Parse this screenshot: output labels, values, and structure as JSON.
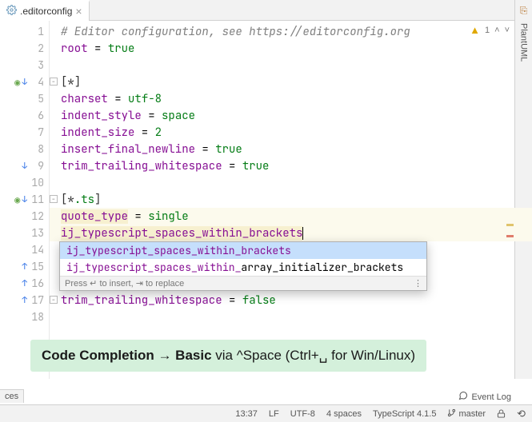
{
  "tab": {
    "filename": ".editorconfig"
  },
  "side_tool": {
    "label": "PlantUML"
  },
  "inspection": {
    "warning_count": "1"
  },
  "lines": [
    {
      "n": 1,
      "segs": [
        {
          "c": "c-comment",
          "t": "# Editor configuration, see "
        },
        {
          "c": "c-comment",
          "t": "https://editorconfig.org",
          "link": true
        }
      ]
    },
    {
      "n": 2,
      "segs": [
        {
          "c": "c-key",
          "t": "root"
        },
        {
          "c": "c-eq",
          "t": " = "
        },
        {
          "c": "c-val",
          "t": "true"
        }
      ]
    },
    {
      "n": 3,
      "segs": []
    },
    {
      "n": 4,
      "segs": [
        {
          "c": "c-sec",
          "t": "[*]"
        }
      ],
      "eye": true,
      "arrowdn": true,
      "fold": true
    },
    {
      "n": 5,
      "segs": [
        {
          "c": "c-key",
          "t": "charset"
        },
        {
          "c": "c-eq",
          "t": " = "
        },
        {
          "c": "c-val",
          "t": "utf-8"
        }
      ]
    },
    {
      "n": 6,
      "segs": [
        {
          "c": "c-key",
          "t": "indent_style"
        },
        {
          "c": "c-eq",
          "t": " = "
        },
        {
          "c": "c-val",
          "t": "space"
        }
      ]
    },
    {
      "n": 7,
      "segs": [
        {
          "c": "c-key",
          "t": "indent_size"
        },
        {
          "c": "c-eq",
          "t": " = "
        },
        {
          "c": "c-val",
          "t": "2"
        }
      ]
    },
    {
      "n": 8,
      "segs": [
        {
          "c": "c-key",
          "t": "insert_final_newline"
        },
        {
          "c": "c-eq",
          "t": " = "
        },
        {
          "c": "c-val",
          "t": "true"
        }
      ]
    },
    {
      "n": 9,
      "segs": [
        {
          "c": "c-key",
          "t": "trim_trailing_whitespace"
        },
        {
          "c": "c-eq",
          "t": " = "
        },
        {
          "c": "c-val",
          "t": "true"
        }
      ],
      "arrowdn": true
    },
    {
      "n": 10,
      "segs": []
    },
    {
      "n": 11,
      "segs": [
        {
          "c": "c-sec",
          "t": "[*"
        },
        {
          "c": "c-val",
          "t": ".ts"
        },
        {
          "c": "c-sec",
          "t": "]"
        }
      ],
      "eye": true,
      "arrowdn": true,
      "fold": true
    },
    {
      "n": 12,
      "segs": [
        {
          "c": "c-key hl-strong",
          "t": "quote_type"
        },
        {
          "c": "c-eq",
          "t": " = "
        },
        {
          "c": "c-val",
          "t": "single"
        }
      ],
      "hl": true
    },
    {
      "n": 13,
      "segs": [
        {
          "c": "c-match hl-strong",
          "t": "ij_typescript_spaces_within_brackets"
        }
      ],
      "hl": true,
      "caret": true
    },
    {
      "n": 14,
      "segs": [],
      "hidden": true
    },
    {
      "n": 15,
      "segs": [],
      "hidden": true,
      "arrowup": true
    },
    {
      "n": 16,
      "segs": [],
      "arrowup": true
    },
    {
      "n": 17,
      "segs": [
        {
          "c": "c-key",
          "t": "trim_trailing_whitespace"
        },
        {
          "c": "c-eq",
          "t": " = "
        },
        {
          "c": "c-val",
          "t": "false"
        }
      ],
      "arrowup": true,
      "fold": true
    },
    {
      "n": 18,
      "segs": []
    }
  ],
  "completion": {
    "items": [
      {
        "prefix": "ij_typescript_spaces_within_brackets",
        "rest": ""
      },
      {
        "prefix": "ij_typescript_spaces_within_",
        "rest": "array_initializer_brackets"
      }
    ],
    "footer": "Press ↵ to insert, ⇥ to replace"
  },
  "hint": {
    "strong1": "Code Completion",
    "arrow": " → ",
    "strong2": "Basic",
    "rest": " via ^Space (Ctrl+␣ for Win/Linux)"
  },
  "bottom_left": "ces",
  "event_log": "Event Log",
  "status": {
    "pos": "13:37",
    "le": "LF",
    "enc": "UTF-8",
    "indent": "4 spaces",
    "lang": "TypeScript 4.1.5",
    "branch": "master"
  }
}
